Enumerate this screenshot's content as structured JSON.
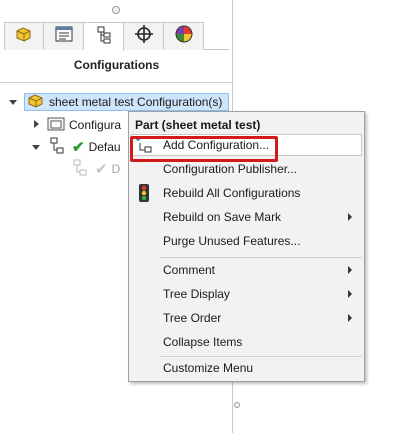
{
  "panel": {
    "title": "Configurations",
    "tabs": [
      {
        "name": "feature-manager",
        "icon": "part-cube-icon"
      },
      {
        "name": "property-manager",
        "icon": "property-list-icon"
      },
      {
        "name": "configuration-manager",
        "icon": "configuration-tree-icon",
        "active": true
      },
      {
        "name": "dimxpert-manager",
        "icon": "crosshair-icon"
      },
      {
        "name": "display-manager",
        "icon": "color-wheel-icon"
      }
    ]
  },
  "tree": {
    "root_label": "sheet metal test Configuration(s)",
    "item_1_label": "Configura",
    "item_2_label": "Defau",
    "item_3_label": "D"
  },
  "context_menu": {
    "header": "Part (sheet metal test)",
    "items": [
      {
        "label": "Add Configuration...",
        "icon": "add-configuration-icon",
        "submenu": false
      },
      {
        "label": "Configuration Publisher...",
        "icon": "",
        "submenu": false
      },
      {
        "label": "Rebuild All Configurations",
        "icon": "traffic-light-icon",
        "submenu": false
      },
      {
        "label": "Rebuild on Save Mark",
        "icon": "",
        "submenu": true
      },
      {
        "label": "Purge Unused Features...",
        "icon": "",
        "submenu": false
      },
      {
        "label": "Comment",
        "icon": "",
        "submenu": true
      },
      {
        "label": "Tree Display",
        "icon": "",
        "submenu": true
      },
      {
        "label": "Tree Order",
        "icon": "",
        "submenu": true
      },
      {
        "label": "Collapse Items",
        "icon": "",
        "submenu": false
      },
      {
        "label": "Customize Menu",
        "icon": "",
        "submenu": false
      }
    ]
  },
  "colors": {
    "highlight_red": "#d11a1a",
    "selection_blue": "#cfe5fb",
    "check_green": "#2f9a2f"
  }
}
